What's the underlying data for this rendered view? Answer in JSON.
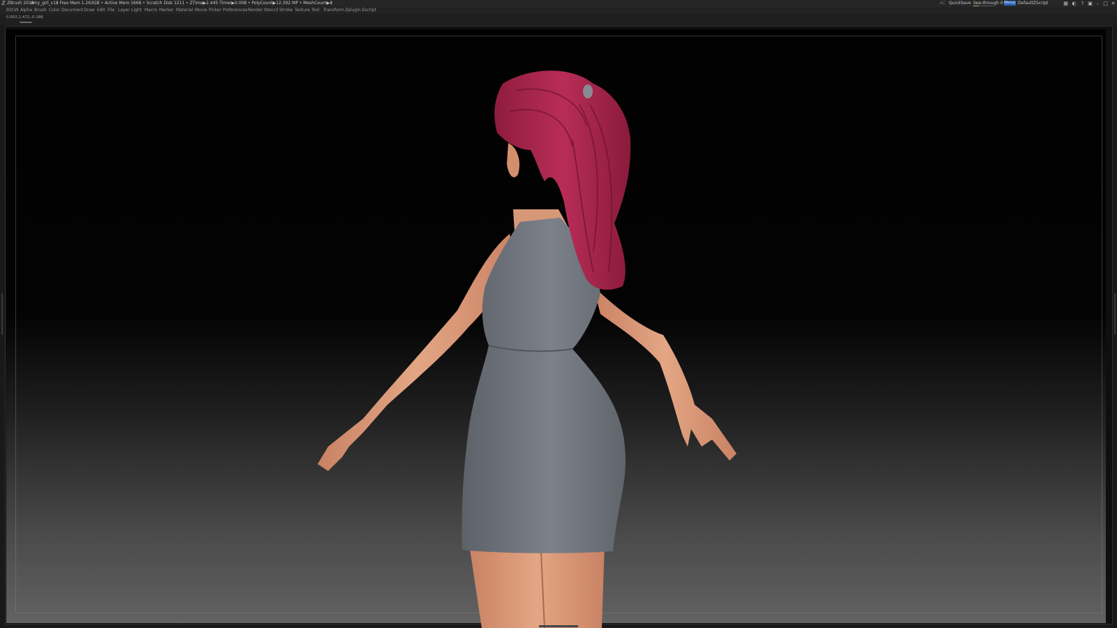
{
  "title_bar": {
    "app_title": "ZBrush 2019",
    "document_name": "amy_girl_v12",
    "stats": "• Free Mem 1.263GB • Active Mem 1668 • Scratch Disk 1211 • ZTime▶2.445 Timer▶0.008 • PolyCount▶12.392 MP • MeshCount▶8",
    "ac_label": "AC",
    "quicksave_label": "QuickSave",
    "see_through_label": "See-through  0",
    "see_through_value": 0,
    "menus_label": "Menus",
    "default_script_label": "DefaultZScript",
    "icons": [
      "layout-icon",
      "palette-icon",
      "help-icon",
      "lock-icon",
      "minimize-icon",
      "restore-icon",
      "close-icon"
    ]
  },
  "menu_bar": {
    "items": [
      "3DCW",
      "Alpha",
      "Brush",
      "Color",
      "Document",
      "Draw",
      "Edit",
      "File",
      "Layer",
      "Light",
      "Macro",
      "Marker",
      "Material",
      "Movie",
      "Picker",
      "Preferences",
      "Render",
      "Stencil",
      "Stroke",
      "Texture",
      "Tool",
      "Transform",
      "Zplugin",
      "Zscript"
    ]
  },
  "info": {
    "coordinates": "0.002,1.472,-0.186"
  },
  "viewport": {
    "subject": "3D sculpt of a stylized girl with red ponytail in grey dress, viewed from behind",
    "colors": {
      "hair": "#a8264e",
      "skin": "#d99a78",
      "dress": "#6f747c",
      "hair_tie": "#8a8a92",
      "background_top": "#020202",
      "background_bottom": "#626262"
    }
  }
}
